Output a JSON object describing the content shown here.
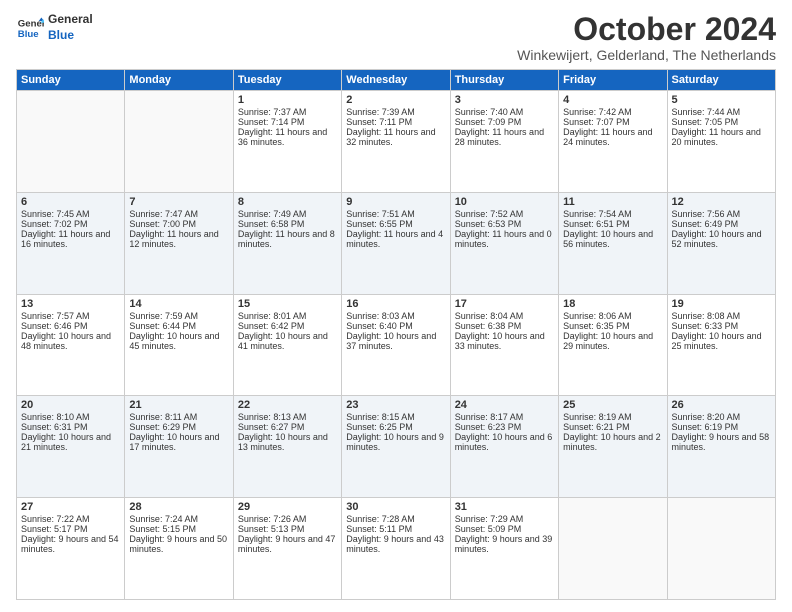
{
  "logo": {
    "line1": "General",
    "line2": "Blue"
  },
  "title": "October 2024",
  "subtitle": "Winkewijert, Gelderland, The Netherlands",
  "days": [
    "Sunday",
    "Monday",
    "Tuesday",
    "Wednesday",
    "Thursday",
    "Friday",
    "Saturday"
  ],
  "weeks": [
    [
      {
        "day": "",
        "sunrise": "",
        "sunset": "",
        "daylight": ""
      },
      {
        "day": "",
        "sunrise": "",
        "sunset": "",
        "daylight": ""
      },
      {
        "day": "1",
        "sunrise": "Sunrise: 7:37 AM",
        "sunset": "Sunset: 7:14 PM",
        "daylight": "Daylight: 11 hours and 36 minutes."
      },
      {
        "day": "2",
        "sunrise": "Sunrise: 7:39 AM",
        "sunset": "Sunset: 7:11 PM",
        "daylight": "Daylight: 11 hours and 32 minutes."
      },
      {
        "day": "3",
        "sunrise": "Sunrise: 7:40 AM",
        "sunset": "Sunset: 7:09 PM",
        "daylight": "Daylight: 11 hours and 28 minutes."
      },
      {
        "day": "4",
        "sunrise": "Sunrise: 7:42 AM",
        "sunset": "Sunset: 7:07 PM",
        "daylight": "Daylight: 11 hours and 24 minutes."
      },
      {
        "day": "5",
        "sunrise": "Sunrise: 7:44 AM",
        "sunset": "Sunset: 7:05 PM",
        "daylight": "Daylight: 11 hours and 20 minutes."
      }
    ],
    [
      {
        "day": "6",
        "sunrise": "Sunrise: 7:45 AM",
        "sunset": "Sunset: 7:02 PM",
        "daylight": "Daylight: 11 hours and 16 minutes."
      },
      {
        "day": "7",
        "sunrise": "Sunrise: 7:47 AM",
        "sunset": "Sunset: 7:00 PM",
        "daylight": "Daylight: 11 hours and 12 minutes."
      },
      {
        "day": "8",
        "sunrise": "Sunrise: 7:49 AM",
        "sunset": "Sunset: 6:58 PM",
        "daylight": "Daylight: 11 hours and 8 minutes."
      },
      {
        "day": "9",
        "sunrise": "Sunrise: 7:51 AM",
        "sunset": "Sunset: 6:55 PM",
        "daylight": "Daylight: 11 hours and 4 minutes."
      },
      {
        "day": "10",
        "sunrise": "Sunrise: 7:52 AM",
        "sunset": "Sunset: 6:53 PM",
        "daylight": "Daylight: 11 hours and 0 minutes."
      },
      {
        "day": "11",
        "sunrise": "Sunrise: 7:54 AM",
        "sunset": "Sunset: 6:51 PM",
        "daylight": "Daylight: 10 hours and 56 minutes."
      },
      {
        "day": "12",
        "sunrise": "Sunrise: 7:56 AM",
        "sunset": "Sunset: 6:49 PM",
        "daylight": "Daylight: 10 hours and 52 minutes."
      }
    ],
    [
      {
        "day": "13",
        "sunrise": "Sunrise: 7:57 AM",
        "sunset": "Sunset: 6:46 PM",
        "daylight": "Daylight: 10 hours and 48 minutes."
      },
      {
        "day": "14",
        "sunrise": "Sunrise: 7:59 AM",
        "sunset": "Sunset: 6:44 PM",
        "daylight": "Daylight: 10 hours and 45 minutes."
      },
      {
        "day": "15",
        "sunrise": "Sunrise: 8:01 AM",
        "sunset": "Sunset: 6:42 PM",
        "daylight": "Daylight: 10 hours and 41 minutes."
      },
      {
        "day": "16",
        "sunrise": "Sunrise: 8:03 AM",
        "sunset": "Sunset: 6:40 PM",
        "daylight": "Daylight: 10 hours and 37 minutes."
      },
      {
        "day": "17",
        "sunrise": "Sunrise: 8:04 AM",
        "sunset": "Sunset: 6:38 PM",
        "daylight": "Daylight: 10 hours and 33 minutes."
      },
      {
        "day": "18",
        "sunrise": "Sunrise: 8:06 AM",
        "sunset": "Sunset: 6:35 PM",
        "daylight": "Daylight: 10 hours and 29 minutes."
      },
      {
        "day": "19",
        "sunrise": "Sunrise: 8:08 AM",
        "sunset": "Sunset: 6:33 PM",
        "daylight": "Daylight: 10 hours and 25 minutes."
      }
    ],
    [
      {
        "day": "20",
        "sunrise": "Sunrise: 8:10 AM",
        "sunset": "Sunset: 6:31 PM",
        "daylight": "Daylight: 10 hours and 21 minutes."
      },
      {
        "day": "21",
        "sunrise": "Sunrise: 8:11 AM",
        "sunset": "Sunset: 6:29 PM",
        "daylight": "Daylight: 10 hours and 17 minutes."
      },
      {
        "day": "22",
        "sunrise": "Sunrise: 8:13 AM",
        "sunset": "Sunset: 6:27 PM",
        "daylight": "Daylight: 10 hours and 13 minutes."
      },
      {
        "day": "23",
        "sunrise": "Sunrise: 8:15 AM",
        "sunset": "Sunset: 6:25 PM",
        "daylight": "Daylight: 10 hours and 9 minutes."
      },
      {
        "day": "24",
        "sunrise": "Sunrise: 8:17 AM",
        "sunset": "Sunset: 6:23 PM",
        "daylight": "Daylight: 10 hours and 6 minutes."
      },
      {
        "day": "25",
        "sunrise": "Sunrise: 8:19 AM",
        "sunset": "Sunset: 6:21 PM",
        "daylight": "Daylight: 10 hours and 2 minutes."
      },
      {
        "day": "26",
        "sunrise": "Sunrise: 8:20 AM",
        "sunset": "Sunset: 6:19 PM",
        "daylight": "Daylight: 9 hours and 58 minutes."
      }
    ],
    [
      {
        "day": "27",
        "sunrise": "Sunrise: 7:22 AM",
        "sunset": "Sunset: 5:17 PM",
        "daylight": "Daylight: 9 hours and 54 minutes."
      },
      {
        "day": "28",
        "sunrise": "Sunrise: 7:24 AM",
        "sunset": "Sunset: 5:15 PM",
        "daylight": "Daylight: 9 hours and 50 minutes."
      },
      {
        "day": "29",
        "sunrise": "Sunrise: 7:26 AM",
        "sunset": "Sunset: 5:13 PM",
        "daylight": "Daylight: 9 hours and 47 minutes."
      },
      {
        "day": "30",
        "sunrise": "Sunrise: 7:28 AM",
        "sunset": "Sunset: 5:11 PM",
        "daylight": "Daylight: 9 hours and 43 minutes."
      },
      {
        "day": "31",
        "sunrise": "Sunrise: 7:29 AM",
        "sunset": "Sunset: 5:09 PM",
        "daylight": "Daylight: 9 hours and 39 minutes."
      },
      {
        "day": "",
        "sunrise": "",
        "sunset": "",
        "daylight": ""
      },
      {
        "day": "",
        "sunrise": "",
        "sunset": "",
        "daylight": ""
      }
    ]
  ]
}
